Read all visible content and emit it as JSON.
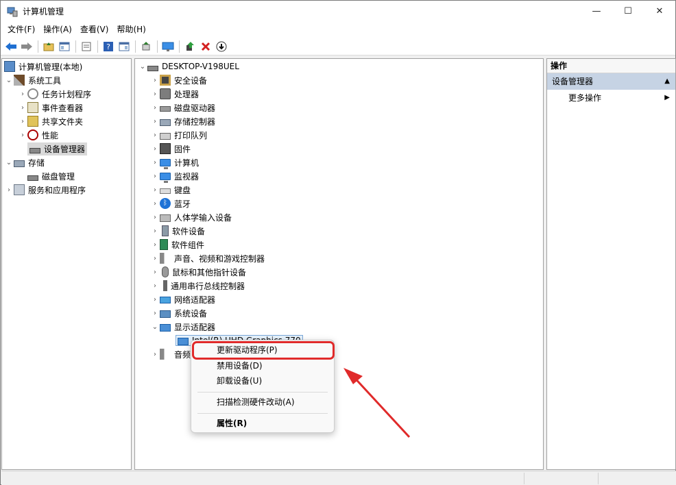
{
  "window": {
    "title": "计算机管理",
    "controls": {
      "minimize": "—",
      "maximize": "☐",
      "close": "✕"
    }
  },
  "menubar": {
    "items": [
      "文件(F)",
      "操作(A)",
      "查看(V)",
      "帮助(H)"
    ]
  },
  "toolbar": {
    "buttons": [
      "back-arrow-icon",
      "forward-arrow-icon",
      "up-folder-icon",
      "show-hide-tree-icon",
      "properties-icon",
      "help-icon",
      "show-action-pane-icon",
      "export-icon",
      "monitor-icon",
      "update-driver-icon",
      "uninstall-x-icon",
      "download-icon"
    ],
    "colors": {
      "back": "#1f6fd1",
      "forward": "#2e7d2e",
      "uninstall": "#d32020"
    }
  },
  "left_tree": {
    "root": "计算机管理(本地)",
    "items": [
      {
        "label": "系统工具",
        "expanded": true
      },
      {
        "label": "任务计划程序"
      },
      {
        "label": "事件查看器"
      },
      {
        "label": "共享文件夹"
      },
      {
        "label": "性能"
      },
      {
        "label": "设备管理器",
        "selected": true
      },
      {
        "label": "存储",
        "expanded": true
      },
      {
        "label": "磁盘管理"
      },
      {
        "label": "服务和应用程序"
      }
    ]
  },
  "device_tree": {
    "root": "DESKTOP-V198UEL",
    "categories": [
      "安全设备",
      "处理器",
      "磁盘驱动器",
      "存储控制器",
      "打印队列",
      "固件",
      "计算机",
      "监视器",
      "键盘",
      "蓝牙",
      "人体学输入设备",
      "软件设备",
      "软件组件",
      "声音、视频和游戏控制器",
      "鼠标和其他指针设备",
      "通用串行总线控制器",
      "网络适配器",
      "系统设备",
      "显示适配器"
    ],
    "display_child": "Intel(R) UHD Graphics 770",
    "partial_next": "音频"
  },
  "actions_pane": {
    "header": "操作",
    "section": "设备管理器",
    "section_arrow": "▲",
    "item": "更多操作",
    "item_arrow": "▶",
    "section_color": "#c6d3e4"
  },
  "context_menu": {
    "items": [
      "更新驱动程序(P)",
      "禁用设备(D)",
      "卸载设备(U)",
      "扫描检测硬件改动(A)",
      "属性(R)"
    ],
    "highlighted": "更新驱动程序(P)"
  },
  "annotation": {
    "highlight_color": "#e02a2a"
  }
}
